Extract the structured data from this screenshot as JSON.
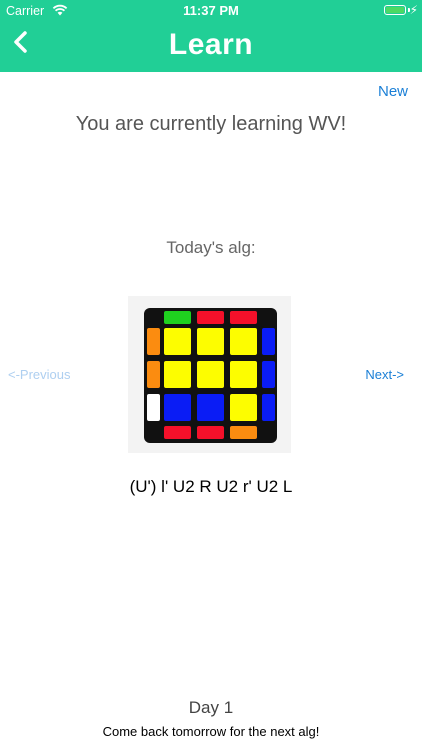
{
  "status_bar": {
    "carrier": "Carrier",
    "time": "11:37 PM",
    "wifi_icon": "wifi-icon",
    "battery_icon": "battery-icon",
    "charging_icon": "charging-bolt-icon"
  },
  "nav": {
    "back_icon": "chevron-left-icon",
    "title": "Learn",
    "bg_color": "#21cf96"
  },
  "new_label": "New",
  "learning_text": "You are currently learning WV!",
  "today_label": "Today's alg:",
  "prev_label": "<-Previous",
  "next_label": "Next->",
  "cube": {
    "top_edge": [
      "green",
      "red",
      "red"
    ],
    "left_edge": [
      "orange",
      "orange",
      "white"
    ],
    "right_edge": [
      "blue",
      "blue",
      "blue"
    ],
    "bottom_edge": [
      "red",
      "red",
      "orange"
    ],
    "face": [
      [
        "yellow",
        "yellow",
        "yellow"
      ],
      [
        "yellow",
        "yellow",
        "yellow"
      ],
      [
        "blue",
        "blue",
        "yellow"
      ]
    ],
    "colors": {
      "yellow": "#fdfd00",
      "blue": "#0a1cf5",
      "red": "#f5102a",
      "green": "#1fd11f",
      "orange": "#fb8c10",
      "white": "#ffffff"
    }
  },
  "algorithm": "(U') l' U2 R U2 r' U2 L",
  "day_label": "Day 1",
  "come_back_text": "Come back tomorrow for the next alg!"
}
